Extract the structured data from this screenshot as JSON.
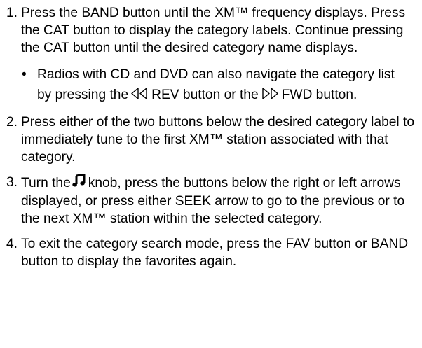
{
  "steps": [
    {
      "number": "1.",
      "text": "Press the BAND button until the XM™ frequency displays. Press the CAT button to display the category labels. Continue pressing the CAT button until the desired category name displays.",
      "bullet": {
        "marker": "•",
        "text_before": "Radios with CD and DVD can also navigate the category list by pressing the",
        "rev_icon": "rewind-double-triangle-icon",
        "text_middle": "REV button or the",
        "fwd_icon": "fast-forward-double-triangle-icon",
        "text_after": "FWD button."
      }
    },
    {
      "number": "2.",
      "text": "Press either of the two buttons below the desired category label to immediately tune to the first XM™ station associated with that category."
    },
    {
      "number": "3.",
      "text_before": "Turn the",
      "knob_icon": "music-note-icon",
      "text_after": "knob, press the buttons below the right or left arrows displayed, or press either SEEK arrow to go to the previous or to the next XM™ station within the selected category."
    },
    {
      "number": "4.",
      "text": "To exit the category search mode, press the FAV button or BAND button to display the favorites again."
    }
  ]
}
